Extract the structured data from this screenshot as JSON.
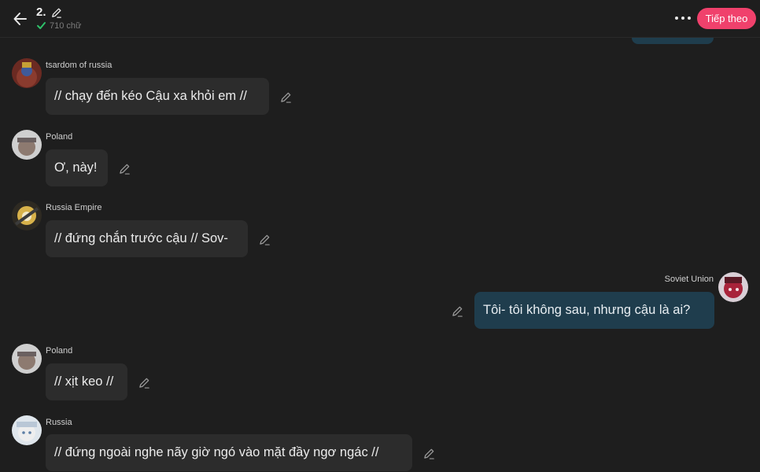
{
  "header": {
    "title": "2.",
    "word_count": "710 chữ",
    "next_label": "Tiếp theo",
    "accent": "#f0416c"
  },
  "icons": {
    "back": "arrow-left-icon",
    "edit": "pencil-icon",
    "check": "check-icon",
    "more": "more-dots-icon"
  },
  "colors": {
    "background": "#1e1e1e",
    "bubble_left": "#2c2c2c",
    "bubble_right": "#1f3d4d",
    "check_green": "#2ec26a"
  },
  "messages": [
    {
      "name": "tsardom of russia",
      "text": "// chạy đến kéo Cậu xa khỏi em //",
      "side": "left"
    },
    {
      "name": "Poland",
      "text": "Ơ, này!",
      "side": "left"
    },
    {
      "name": "Russia Empire",
      "text": "// đứng chắn trước cậu // Sov-",
      "side": "left"
    },
    {
      "name": "Soviet Union",
      "text": "Tôi- tôi không sau, nhưng cậu là ai?",
      "side": "right"
    },
    {
      "name": "Poland",
      "text": "// xịt keo //",
      "side": "left"
    },
    {
      "name": "Russia",
      "text": "// đứng ngoài nghe nãy giờ ngó vào mặt đầy ngơ ngác //",
      "side": "left"
    }
  ]
}
